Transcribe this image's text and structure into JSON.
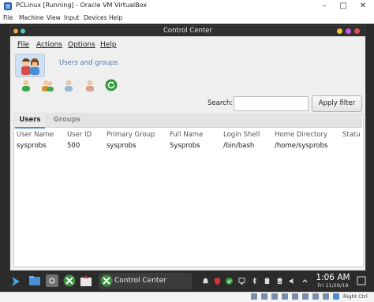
{
  "host": {
    "title": "PCLinux [Running] - Oracle VM VirtualBox",
    "menu": [
      "File",
      "Machine",
      "View",
      "Input",
      "Devices",
      "Help"
    ],
    "host_key": "Right Ctrl"
  },
  "window": {
    "title": "Control Center",
    "menu": [
      "File",
      "Actions",
      "Options",
      "Help"
    ],
    "section_label": "Users and groups",
    "toolbar_icons": [
      "add-user-icon",
      "add-group-icon",
      "edit-user-icon",
      "delete-user-icon",
      "refresh-icon"
    ]
  },
  "search": {
    "label": "Search:",
    "value": "",
    "button": "Apply filter"
  },
  "tabs": [
    "Users",
    "Groups"
  ],
  "table": {
    "columns": [
      "User Name",
      "User ID",
      "Primary Group",
      "Full Name",
      "Login Shell",
      "Home Directory",
      "Statu"
    ],
    "rows": [
      [
        "sysprobs",
        "500",
        "sysprobs",
        "Sysprobs",
        "/bin/bash",
        "/home/sysprobs",
        ""
      ]
    ]
  },
  "taskbar": {
    "active_window": "Control Center",
    "time": "1:06 AM",
    "date": "Fri 11/29/19"
  },
  "colors": {
    "accent": "#5a8ac6",
    "link": "#4a76b3",
    "dark_panel": "#2b2b2b"
  }
}
